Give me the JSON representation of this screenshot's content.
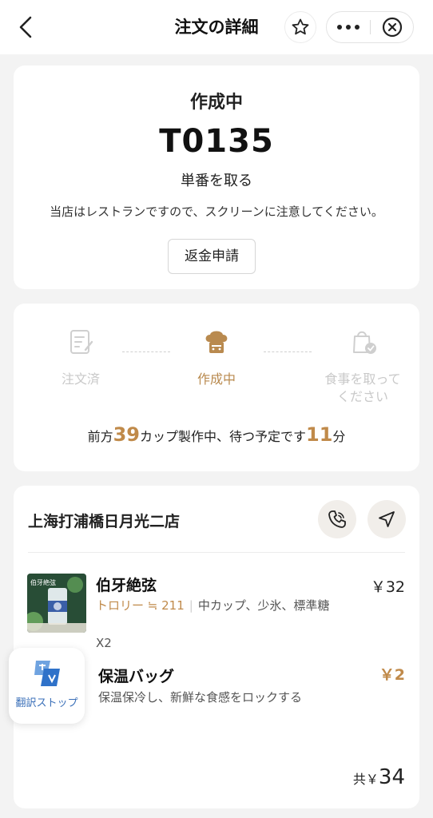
{
  "nav": {
    "title": "注文の詳細"
  },
  "status": {
    "title": "作成中",
    "order_number": "T0135",
    "pickup_label": "単番を取る",
    "notice": "当店はレストランですので、スクリーンに注意してください。",
    "refund_button": "返金申請"
  },
  "progress": {
    "steps": [
      {
        "label": "注文済",
        "state": "done"
      },
      {
        "label": "作成中",
        "state": "active"
      },
      {
        "label": "食事を取って\nください",
        "state": "pending"
      }
    ],
    "queue_prefix": "前方",
    "cups_ahead": "39",
    "queue_middle": "カップ製作中、待つ予定です",
    "wait_minutes": "11",
    "queue_suffix": "分"
  },
  "store": {
    "name": "上海打浦橋日月光二店"
  },
  "items": [
    {
      "name": "伯牙絶弦",
      "price": "￥32",
      "trolley": "トロリー ≒ 211",
      "options": "中カップ、少氷、標準糖",
      "qty": "X2",
      "thumb_text": "伯牙絶弦"
    }
  ],
  "bag": {
    "name": "保温バッグ",
    "price": "￥2",
    "desc": "保温保冷し、新鮮な食感をロックする"
  },
  "total": {
    "label": "共￥",
    "amount": "34"
  },
  "translate": {
    "label": "翻訳ストップ"
  },
  "colors": {
    "accent": "#c08a4a",
    "background": "#f3f3f3",
    "card": "#ffffff",
    "translate_blue": "#3a6fb8"
  }
}
